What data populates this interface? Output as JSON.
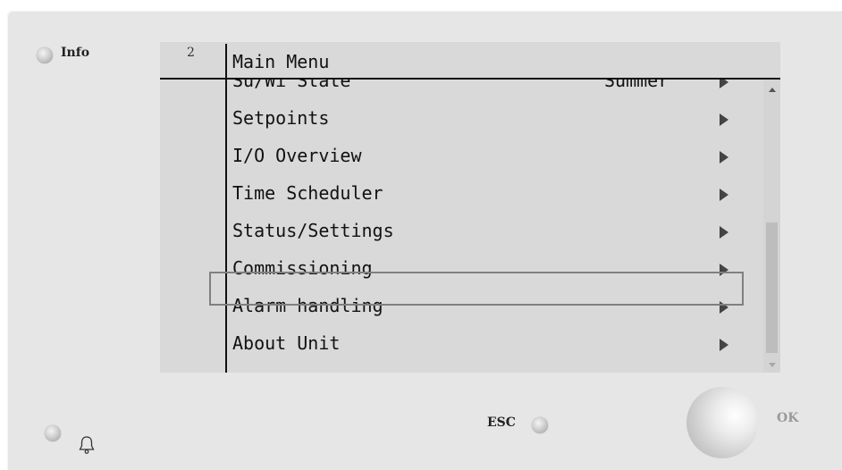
{
  "device": {
    "info_label": "Info",
    "esc_label": "ESC",
    "ok_label": "OK"
  },
  "screen": {
    "page_number": "2",
    "title": "Main Menu",
    "selected_item": "Commissioning",
    "items": [
      {
        "label": "Su/Wi State",
        "value": "Summer"
      },
      {
        "label": "Setpoints",
        "value": ""
      },
      {
        "label": "I/O Overview",
        "value": ""
      },
      {
        "label": "Time Scheduler",
        "value": ""
      },
      {
        "label": "Status/Settings",
        "value": ""
      },
      {
        "label": "Commissioning",
        "value": ""
      },
      {
        "label": "Alarm handling",
        "value": ""
      },
      {
        "label": "About Unit",
        "value": ""
      }
    ]
  },
  "icons": {
    "alarm": "bell-icon",
    "submenu": "triangle-right-icon",
    "scroll_up": "scroll-up-icon",
    "scroll_down": "scroll-down-icon"
  },
  "colors": {
    "panel": "#e6e6e6",
    "screen": "#d9d9d9",
    "highlight_border": "#808080",
    "text": "#111111"
  }
}
